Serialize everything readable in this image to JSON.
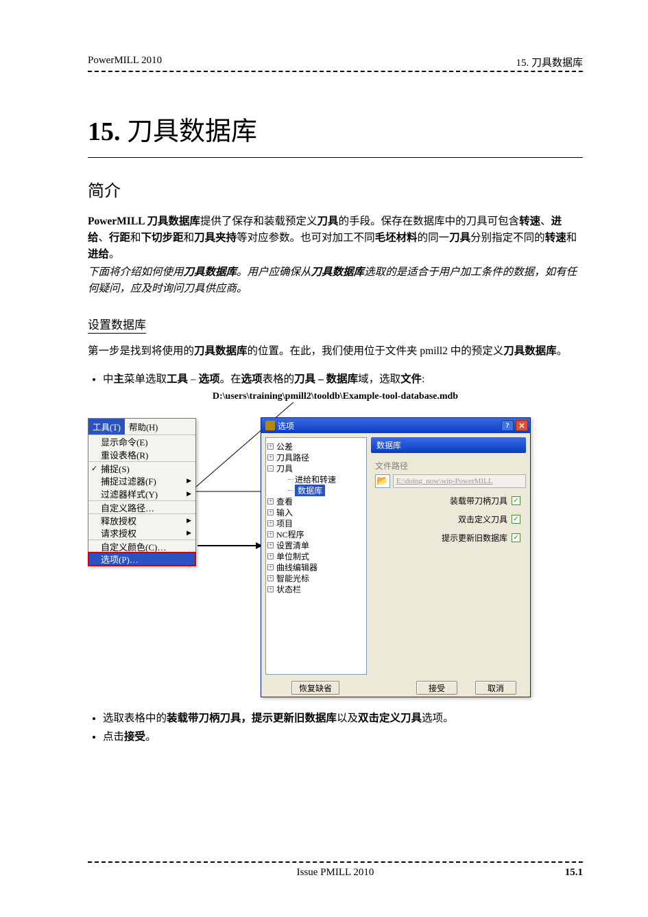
{
  "header": {
    "left": "PowerMILL 2010",
    "right": "15. 刀具数据库"
  },
  "chapter": {
    "num": "15.",
    "title": "刀具数据库"
  },
  "section_intro": "简介",
  "intro_html": "<b>PowerMILL 刀具数据库</b>提供了保存和装载预定义<b>刀具</b>的手段。保存在数据库中的刀具可包含<b>转速</b>、<b>进给</b>、<b>行距</b>和<b>下切步距</b>和<b>刀具夹持</b>等对应参数。也可对加工不同<b>毛坯材料</b>的同一<b>刀具</b>分别指定不同的<b>转速</b>和<b>进给</b>。",
  "intro_italic": "下面将介绍如何使用<b>刀具数据库</b>。用户应确保从<b>刀具数据库</b>选取的是适合于用户加工条件的数据，如有任何疑问，应及时询问刀具供应商。",
  "section_setup": "设置数据库",
  "setup_text": "第一步是找到将使用的<b>刀具数据库</b>的位置。在此，我们使用位于文件夹 pmill2 中的预定义<b>刀具数据库</b>。",
  "bullet1": "中<b>主</b>菜单选取<b>工具</b> – <b>选项</b>。在<b>选项</b>表格的<b>刀具 – 数据库</b>域，选取<b>文件</b>:",
  "path": "D:\\users\\training\\pmill2\\tooldb\\Example-tool-database.mdb",
  "menu": {
    "tab_tool": "工具(T)",
    "tab_help": "帮助(H)",
    "items": [
      {
        "label": "显示命令(E)",
        "checked": false,
        "sub": false
      },
      {
        "label": "重设表格(R)",
        "checked": false,
        "sub": false
      },
      {
        "label": "捕捉(S)",
        "checked": true,
        "sub": false,
        "sep": true
      },
      {
        "label": "捕捉过滤器(F)",
        "checked": false,
        "sub": true
      },
      {
        "label": "过滤器样式(Y)",
        "checked": false,
        "sub": true
      },
      {
        "label": "自定义路径…",
        "checked": false,
        "sub": false,
        "sep": true
      },
      {
        "label": "释放授权",
        "checked": false,
        "sub": true,
        "sep": true
      },
      {
        "label": "请求授权",
        "checked": false,
        "sub": true
      },
      {
        "label": "自定义颜色(C)…",
        "checked": false,
        "sub": false,
        "sep": true
      },
      {
        "label": "选项(P)…",
        "checked": false,
        "sub": false,
        "highlight": true
      }
    ]
  },
  "dialog": {
    "title": "选项",
    "tree": {
      "items": [
        {
          "label": "公差",
          "exp": "+"
        },
        {
          "label": "刀具路径",
          "exp": "+"
        },
        {
          "label": "刀具",
          "exp": "-"
        },
        {
          "label": "进给和转速",
          "indent": 2
        },
        {
          "label": "数据库",
          "indent": 2,
          "selected": true
        },
        {
          "label": "查看",
          "exp": "+"
        },
        {
          "label": "输入",
          "exp": "+"
        },
        {
          "label": "项目",
          "exp": "+"
        },
        {
          "label": "NC程序",
          "exp": "+"
        },
        {
          "label": "设置清单",
          "exp": "+"
        },
        {
          "label": "单位制式",
          "exp": "+"
        },
        {
          "label": "曲线编辑器",
          "exp": "+"
        },
        {
          "label": "智能光标",
          "exp": "+"
        },
        {
          "label": "状态栏",
          "exp": "+"
        }
      ]
    },
    "group": "数据库",
    "path_label": "文件路径",
    "path_value": "E:\\doing_now\\wip-PowerMILL",
    "checks": [
      "装载带刀柄刀具",
      "双击定义刀具",
      "提示更新旧数据库"
    ],
    "buttons": {
      "reset": "恢复缺省",
      "accept": "接受",
      "cancel": "取消"
    }
  },
  "bullet2": "选取表格中的<b>装载带刀柄刀具，提示更新旧数据库</b>以及<b>双击定义刀具</b>选项。",
  "bullet3": "点击<b>接受</b>。",
  "footer": {
    "issue": "Issue PMILL 2010",
    "page": "15.1"
  }
}
